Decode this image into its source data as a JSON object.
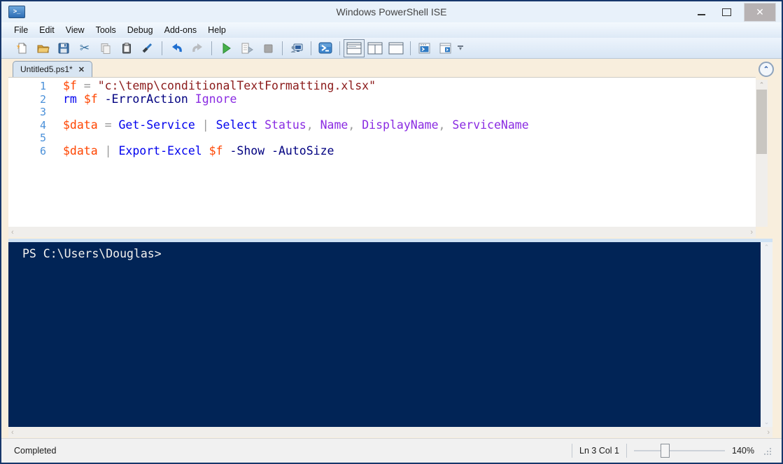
{
  "window": {
    "title": "Windows PowerShell ISE",
    "close_glyph": "✕"
  },
  "menu": {
    "items": [
      "File",
      "Edit",
      "View",
      "Tools",
      "Debug",
      "Add-ons",
      "Help"
    ]
  },
  "toolbar": {
    "buttons": [
      "new-script",
      "open-script",
      "save-script",
      "cut",
      "copy",
      "paste",
      "clear-console-pane",
      "undo",
      "redo",
      "run-script",
      "run-selection",
      "stop-operation",
      "new-remote-powershell-tab",
      "start-powershell-exe",
      "show-script-pane-top",
      "show-script-pane-right",
      "show-script-pane-maximized",
      "new-powershell-tab",
      "show-console-pane",
      "toolbar-overflow"
    ],
    "cut_glyph": "✂"
  },
  "editor": {
    "tab": {
      "label": "Untitled5.ps1*",
      "close_glyph": "✕"
    },
    "collapse_glyph": "︿",
    "lines": [
      {
        "n": "1",
        "tokens": [
          [
            "v",
            "$f"
          ],
          [
            "o",
            " = "
          ],
          [
            "s",
            "\"c:\\temp\\conditionalTextFormatting.xlsx\""
          ]
        ]
      },
      {
        "n": "2",
        "tokens": [
          [
            "c",
            "rm"
          ],
          [
            "t",
            " "
          ],
          [
            "v",
            "$f"
          ],
          [
            "t",
            " "
          ],
          [
            "p",
            "-ErrorAction"
          ],
          [
            "t",
            " "
          ],
          [
            "k",
            "Ignore"
          ]
        ]
      },
      {
        "n": "3",
        "tokens": []
      },
      {
        "n": "4",
        "tokens": [
          [
            "v",
            "$data"
          ],
          [
            "o",
            " = "
          ],
          [
            "c",
            "Get-Service"
          ],
          [
            "o",
            " | "
          ],
          [
            "c",
            "Select"
          ],
          [
            "t",
            " "
          ],
          [
            "k",
            "Status"
          ],
          [
            "o",
            ", "
          ],
          [
            "k",
            "Name"
          ],
          [
            "o",
            ", "
          ],
          [
            "k",
            "DisplayName"
          ],
          [
            "o",
            ", "
          ],
          [
            "k",
            "ServiceName"
          ]
        ]
      },
      {
        "n": "5",
        "tokens": []
      },
      {
        "n": "6",
        "tokens": [
          [
            "v",
            "$data"
          ],
          [
            "o",
            " | "
          ],
          [
            "c",
            "Export-Excel"
          ],
          [
            "t",
            " "
          ],
          [
            "v",
            "$f"
          ],
          [
            "t",
            " "
          ],
          [
            "p",
            "-Show"
          ],
          [
            "t",
            " "
          ],
          [
            "p",
            "-AutoSize"
          ]
        ]
      }
    ]
  },
  "console": {
    "prompt": "PS C:\\Users\\Douglas>"
  },
  "status": {
    "state": "Completed",
    "line_col": "Ln 3 Col 1",
    "zoom_level": "140%"
  },
  "colors": {
    "console_background": "#012456",
    "variable": "#ff4500",
    "command": "#0000ee",
    "parameter": "#000080",
    "argument": "#8a2be2",
    "string": "#8b1a1a",
    "operator": "#9a9a9a",
    "window_border": "#17376b"
  }
}
